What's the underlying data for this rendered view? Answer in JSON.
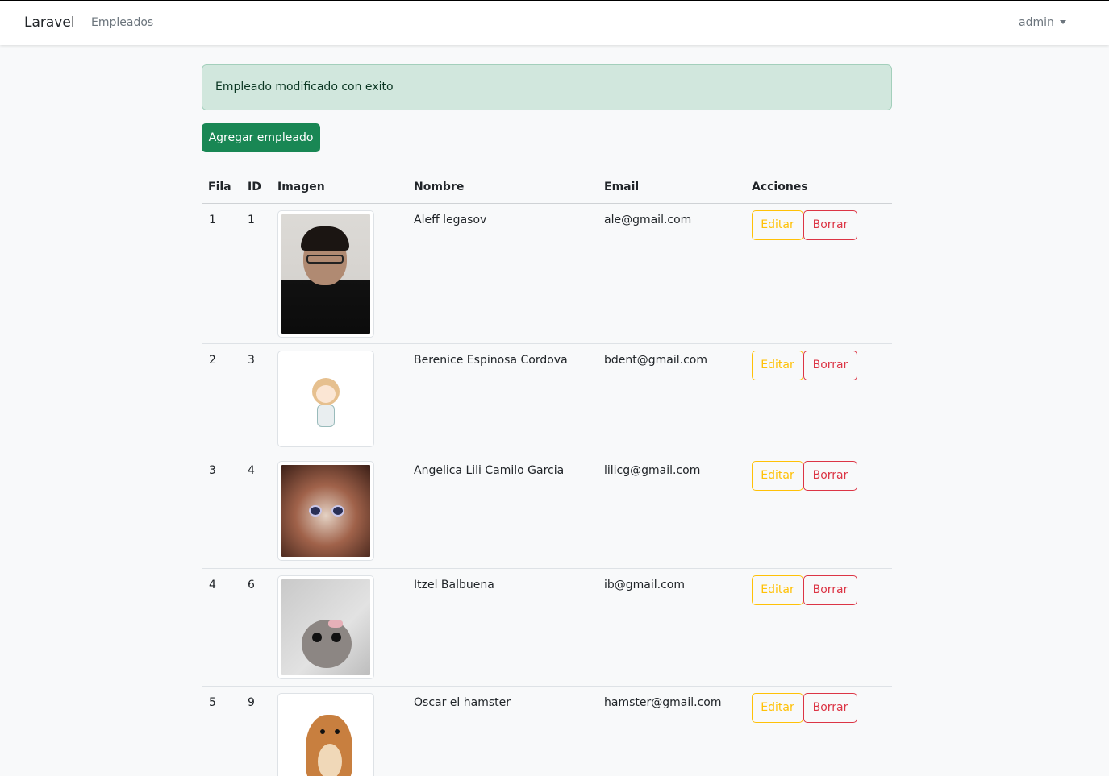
{
  "navbar": {
    "brand": "Laravel",
    "nav_link": "Empleados",
    "user": "admin"
  },
  "alert": {
    "message": "Empleado modificado con exito"
  },
  "actions": {
    "add_label": "Agregar empleado"
  },
  "table": {
    "headers": [
      "Fila",
      "ID",
      "Imagen",
      "Nombre",
      "Email",
      "Acciones"
    ],
    "rows": [
      {
        "fila": "1",
        "id": "1",
        "nombre": "Aleff legasov",
        "email": "ale@gmail.com",
        "edit": "Editar",
        "delete": "Borrar"
      },
      {
        "fila": "2",
        "id": "3",
        "nombre": "Berenice Espinosa Cordova",
        "email": "bdent@gmail.com",
        "edit": "Editar",
        "delete": "Borrar"
      },
      {
        "fila": "3",
        "id": "4",
        "nombre": "Angelica Lili Camilo Garcia",
        "email": "lilicg@gmail.com",
        "edit": "Editar",
        "delete": "Borrar"
      },
      {
        "fila": "4",
        "id": "6",
        "nombre": "Itzel Balbuena",
        "email": "ib@gmail.com",
        "edit": "Editar",
        "delete": "Borrar"
      },
      {
        "fila": "5",
        "id": "9",
        "nombre": "Oscar el hamster",
        "email": "hamster@gmail.com",
        "edit": "Editar",
        "delete": "Borrar"
      }
    ]
  },
  "colors": {
    "success": "#198754",
    "warning": "#ffc107",
    "danger": "#dc3545",
    "alert_bg": "#d1e7dd"
  }
}
